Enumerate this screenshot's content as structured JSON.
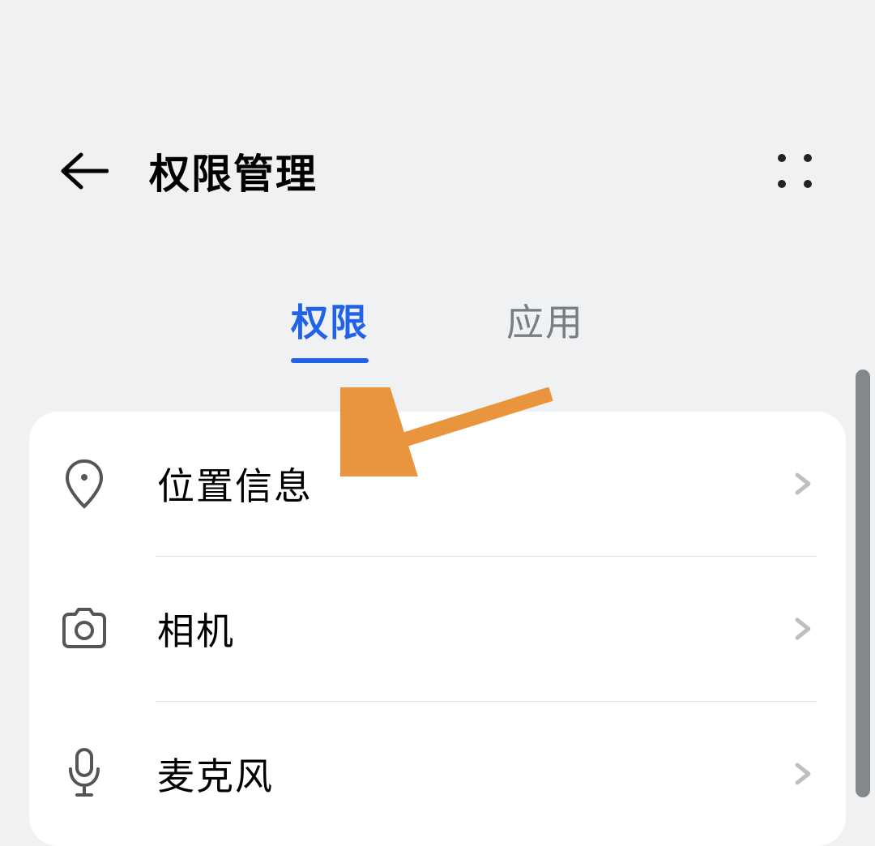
{
  "header": {
    "title": "权限管理"
  },
  "tabs": {
    "permissions": "权限",
    "apps": "应用",
    "active": "permissions"
  },
  "permissions_list": [
    {
      "icon": "location-icon",
      "label": "位置信息"
    },
    {
      "icon": "camera-icon",
      "label": "相机"
    },
    {
      "icon": "microphone-icon",
      "label": "麦克风"
    }
  ],
  "colors": {
    "accent": "#2163e8",
    "annotation": "#e8953d"
  }
}
